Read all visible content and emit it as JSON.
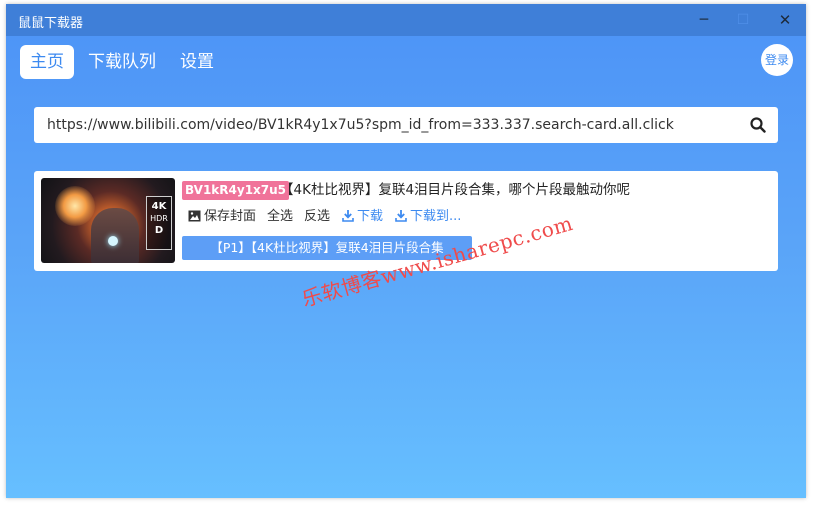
{
  "window": {
    "title": "鼠鼠下载器",
    "controls": {
      "minimize": "─",
      "maximize": "☐",
      "close": "✕"
    }
  },
  "nav": {
    "tabs": [
      {
        "label": "主页",
        "active": true
      },
      {
        "label": "下载队列",
        "active": false
      },
      {
        "label": "设置",
        "active": false
      }
    ],
    "login_label": "登录"
  },
  "search": {
    "value": "https://www.bilibili.com/video/BV1kR4y1x7u5?spm_id_from=333.337.search-card.all.click",
    "icon": "search-icon"
  },
  "video": {
    "bvid": "BV1kR4y1x7u5",
    "title": "【4K杜比视界】复联4泪目片段合集，哪个片段最触动你呢",
    "thumb_badge": [
      "4K",
      "HDR",
      "D"
    ],
    "actions": {
      "save_cover": "保存封面",
      "select_all": "全选",
      "invert_selection": "反选",
      "download": "下载",
      "download_to": "下载到..."
    },
    "parts": [
      {
        "label": "【P1】【4K杜比视界】复联4泪目片段合集",
        "selected": true
      }
    ]
  },
  "watermark": "乐软博客www.isharepc.com",
  "colors": {
    "titlebar": "#3f7fd8",
    "accent": "#3d8af0",
    "bv_badge": "#f0739a",
    "part_selected": "#5d9ef6",
    "watermark": "#ef4b4b"
  }
}
